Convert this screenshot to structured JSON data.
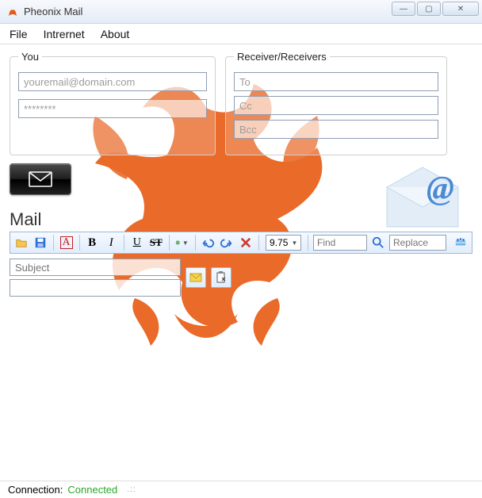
{
  "window": {
    "title": "Pheonix Mail",
    "controls": {
      "min": "—",
      "max": "▢",
      "close": "✕"
    }
  },
  "menubar": {
    "file": "File",
    "internet": "Intrernet",
    "about": "About"
  },
  "you": {
    "legend": "You",
    "email_placeholder": "youremail@domain.com",
    "password_placeholder": "********"
  },
  "receivers": {
    "legend": "Receiver/Receivers",
    "to_placeholder": "To",
    "cc_placeholder": "Cc",
    "bcc_placeholder": "Bcc"
  },
  "mail": {
    "label": "Mail",
    "toolbar": {
      "font_size": "9.75",
      "find_placeholder": "Find",
      "replace_placeholder": "Replace",
      "bold": "B",
      "italic": "I",
      "underline": "U",
      "strike": "ST"
    },
    "subject_placeholder": "Subject"
  },
  "status": {
    "label": "Connection:",
    "value": "Connected"
  },
  "icons": {
    "app": "phoenix-icon",
    "send": "envelope-icon",
    "open": "folder-open-icon",
    "save": "save-icon",
    "font": "font-icon",
    "hyperlink": "globe-icon",
    "undo": "undo-icon",
    "redo": "redo-icon",
    "delete": "delete-x-icon",
    "search": "magnifier-icon",
    "animation": "animation-icon",
    "attach_message": "message-attach-icon",
    "paste": "paste-icon"
  }
}
